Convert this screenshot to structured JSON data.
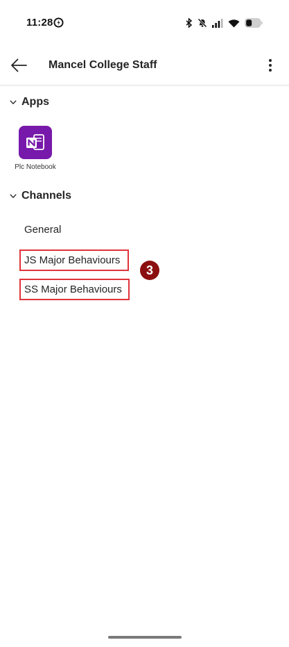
{
  "status_bar": {
    "time": "11:28",
    "icons": [
      "dnd-icon",
      "bluetooth-icon",
      "mute-icon",
      "signal-icon",
      "wifi-icon",
      "battery-icon"
    ]
  },
  "header": {
    "title": "Mancel College Staff",
    "back_icon": "arrow-left-icon",
    "more_icon": "more-vertical-icon"
  },
  "apps": {
    "label": "Apps",
    "items": [
      {
        "label": "Plc Notebook",
        "icon": "onenote-icon",
        "color": "#7719aa"
      }
    ]
  },
  "channels": {
    "label": "Channels",
    "items": [
      {
        "label": "General"
      },
      {
        "label": "JS Major Behaviours",
        "highlighted": true
      },
      {
        "label": "SS Major Behaviours",
        "highlighted": true
      }
    ]
  },
  "annotation": {
    "step_number": "3",
    "highlight_color": "#e0333a",
    "badge_color": "#8b0f10"
  }
}
